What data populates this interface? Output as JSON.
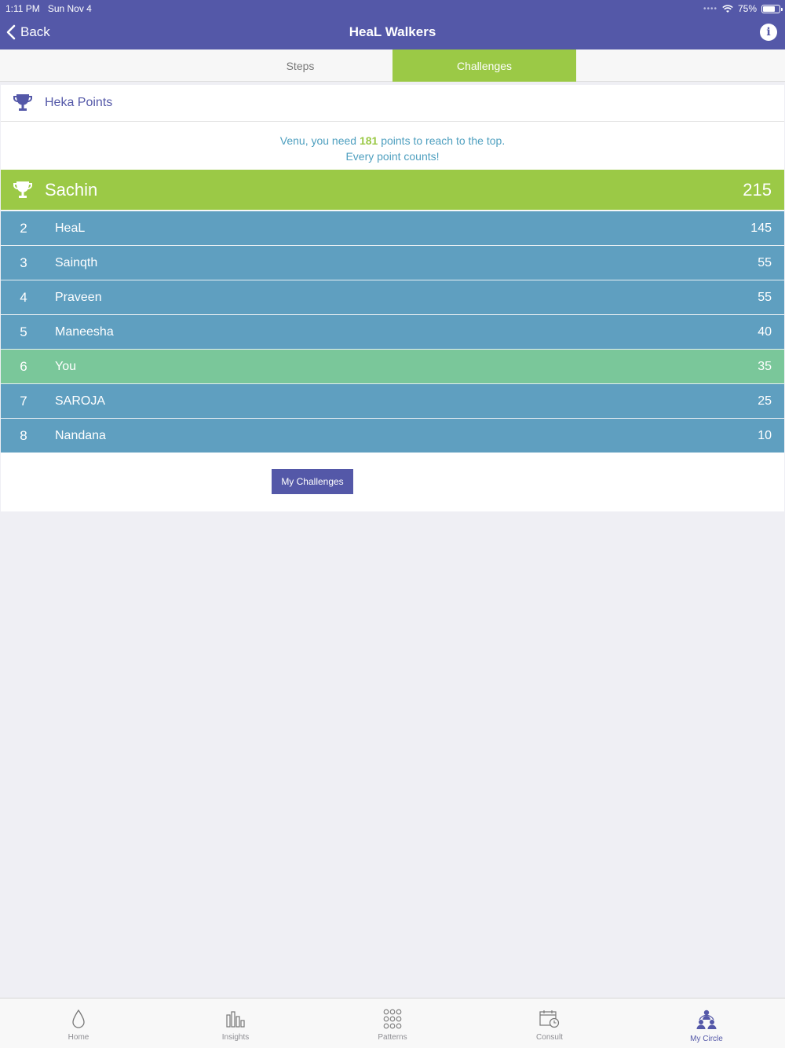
{
  "status": {
    "time": "1:11 PM",
    "date": "Sun Nov 4",
    "battery": "75%",
    "battery_level": 0.75
  },
  "nav": {
    "back": "Back",
    "title": "HeaL Walkers",
    "info": "i"
  },
  "tabs": [
    {
      "label": "Steps",
      "active": false
    },
    {
      "label": "Challenges",
      "active": true
    }
  ],
  "card": {
    "header": "Heka Points",
    "message": {
      "prefix": "Venu, you need ",
      "points": "181",
      "suffix": " points to reach to the top.",
      "line2": "Every point counts!"
    },
    "leader": {
      "name": "Sachin",
      "score": "215"
    },
    "rows": [
      {
        "rank": "2",
        "name": "HeaL",
        "score": "145",
        "highlight": false
      },
      {
        "rank": "3",
        "name": "Sainqth",
        "score": "55",
        "highlight": false
      },
      {
        "rank": "4",
        "name": "Praveen",
        "score": "55",
        "highlight": false
      },
      {
        "rank": "5",
        "name": "Maneesha",
        "score": "40",
        "highlight": false
      },
      {
        "rank": "6",
        "name": "You",
        "score": "35",
        "highlight": true
      },
      {
        "rank": "7",
        "name": "SAROJA",
        "score": "25",
        "highlight": false
      },
      {
        "rank": "8",
        "name": "Nandana",
        "score": "10",
        "highlight": false
      }
    ],
    "button": "My Challenges"
  },
  "bottom_tabs": [
    {
      "label": "Home",
      "icon": "drop-icon",
      "active": false
    },
    {
      "label": "Insights",
      "icon": "bar-chart-icon",
      "active": false
    },
    {
      "label": "Patterns",
      "icon": "grid-dots-icon",
      "active": false
    },
    {
      "label": "Consult",
      "icon": "calendar-clock-icon",
      "active": false
    },
    {
      "label": "My Circle",
      "icon": "people-circle-icon",
      "active": true
    }
  ],
  "colors": {
    "primary": "#5458a8",
    "accent_green": "#9bc946",
    "row_blue": "#5f9fc0",
    "row_you": "#7ac79a",
    "message": "#4e9fbf"
  }
}
